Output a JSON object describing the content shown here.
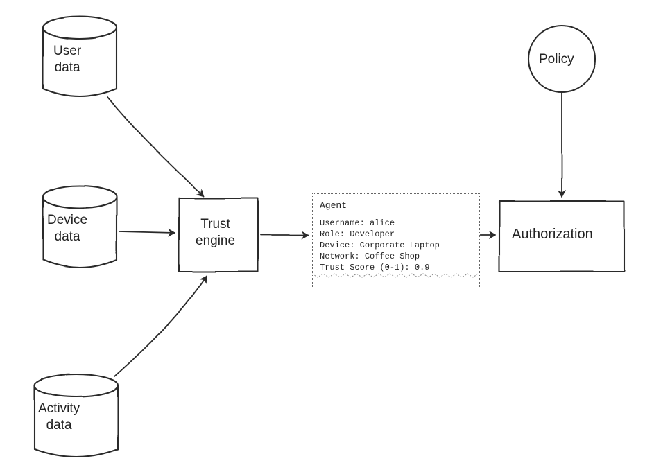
{
  "nodes": {
    "user_data": {
      "label": "User\ndata"
    },
    "device_data": {
      "label": "Device\ndata"
    },
    "activity_data": {
      "label": "Activity\ndata"
    },
    "trust_engine": {
      "label": "Trust\nengine"
    },
    "policy": {
      "label": "Policy"
    },
    "authorization": {
      "label": "Authorization"
    }
  },
  "agent": {
    "title": "Agent",
    "fields": {
      "username_label": "Username:",
      "username_value": "alice",
      "role_label": "Role:",
      "role_value": "Developer",
      "device_label": "Device:",
      "device_value": "Corporate Laptop",
      "network_label": "Network:",
      "network_value": "Coffee Shop",
      "trust_label": "Trust Score (0-1):",
      "trust_value": "0.9"
    }
  }
}
